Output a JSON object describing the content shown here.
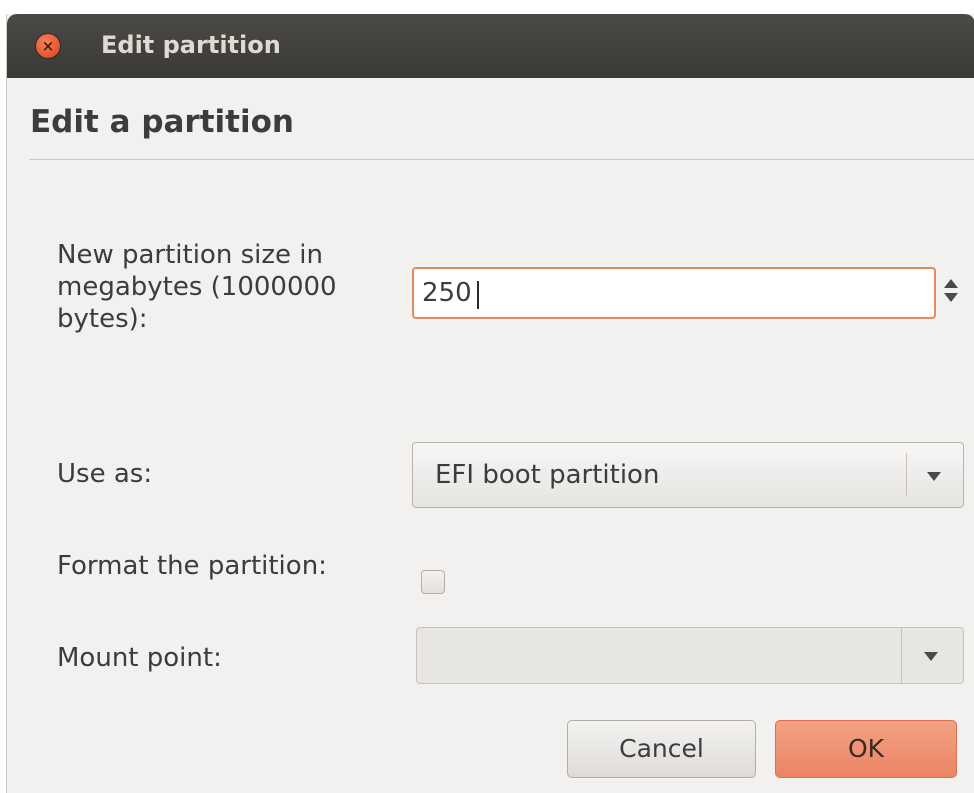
{
  "window": {
    "title": "Edit partition",
    "close_icon_glyph": "×"
  },
  "dialog": {
    "heading": "Edit a partition"
  },
  "form": {
    "size": {
      "label": "New partition size in megabytes (1000000 bytes):",
      "value": "250"
    },
    "use_as": {
      "label": "Use as:",
      "selected": "EFI boot partition"
    },
    "format": {
      "label": "Format the partition:",
      "checked": false
    },
    "mount_point": {
      "label": "Mount point:",
      "selected": ""
    }
  },
  "buttons": {
    "cancel": "Cancel",
    "ok": "OK"
  },
  "icons": {
    "close": "close-icon",
    "spin_up": "chevron-up-icon",
    "spin_down": "chevron-down-icon",
    "dropdown": "chevron-down-icon"
  },
  "colors": {
    "accent": "#ea8564",
    "focus_border": "#e08a5e",
    "titlebar": "#3c3b37",
    "close_button": "#e2522b"
  }
}
